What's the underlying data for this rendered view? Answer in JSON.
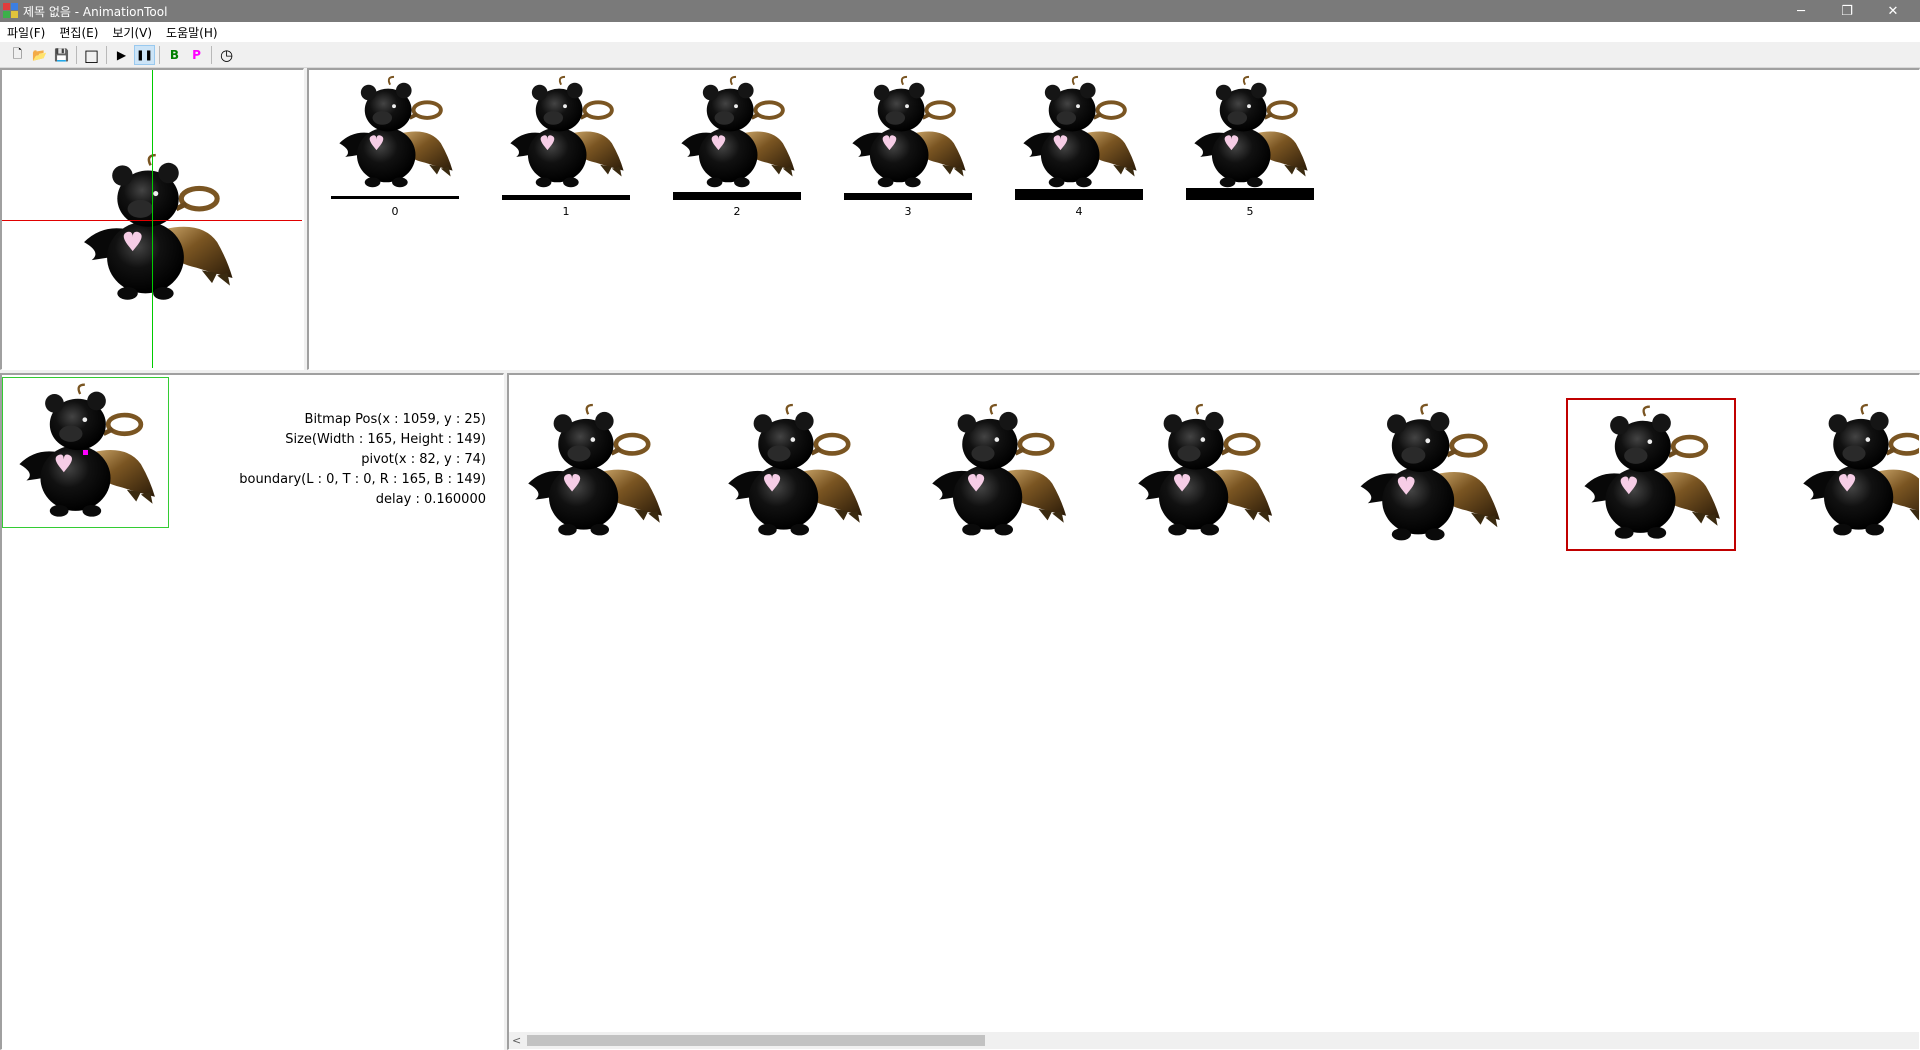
{
  "window": {
    "title": "제목 없음 - AnimationTool",
    "controls": {
      "minimize": "─",
      "restore": "❐",
      "close": "✕"
    }
  },
  "menu": [
    "파일(F)",
    "편집(E)",
    "보기(V)",
    "도움말(H)"
  ],
  "toolbar": {
    "buttons": [
      {
        "name": "new-file-button",
        "glyph": "🗋"
      },
      {
        "name": "open-file-button",
        "glyph": "📂"
      },
      {
        "name": "save-file-button",
        "glyph": "💾"
      },
      {
        "name": "rectangle-tool-button",
        "glyph": "□"
      },
      {
        "name": "play-button",
        "glyph": "▶"
      },
      {
        "name": "pause-button",
        "glyph": "❚❚",
        "active": true
      },
      {
        "name": "b-tool-button",
        "glyph": "B",
        "color": "#008000"
      },
      {
        "name": "p-tool-button",
        "glyph": "P",
        "color": "#ff00ff"
      },
      {
        "name": "timer-button",
        "glyph": "◷"
      }
    ]
  },
  "frames": [
    {
      "label": "0"
    },
    {
      "label": "1"
    },
    {
      "label": "2"
    },
    {
      "label": "3"
    },
    {
      "label": "4"
    },
    {
      "label": "5"
    }
  ],
  "frame_info": {
    "bitmap_pos": "Bitmap Pos(x : 1059, y : 25)",
    "size": "Size(Width : 165, Height : 149)",
    "pivot": "pivot(x : 82, y : 74)",
    "boundary": "boundary(L : 0, T : 0, R : 165, B : 149)",
    "delay": "delay : 0.160000"
  },
  "sprite_sheet": {
    "visible_count": 7,
    "selected_index": 5
  },
  "colors": {
    "crosshair_h": "#e00000",
    "crosshair_v": "#00cc00",
    "selection_box": "#c00000",
    "frame_border": "#33cc33",
    "pivot_dot": "#ff00ff"
  }
}
